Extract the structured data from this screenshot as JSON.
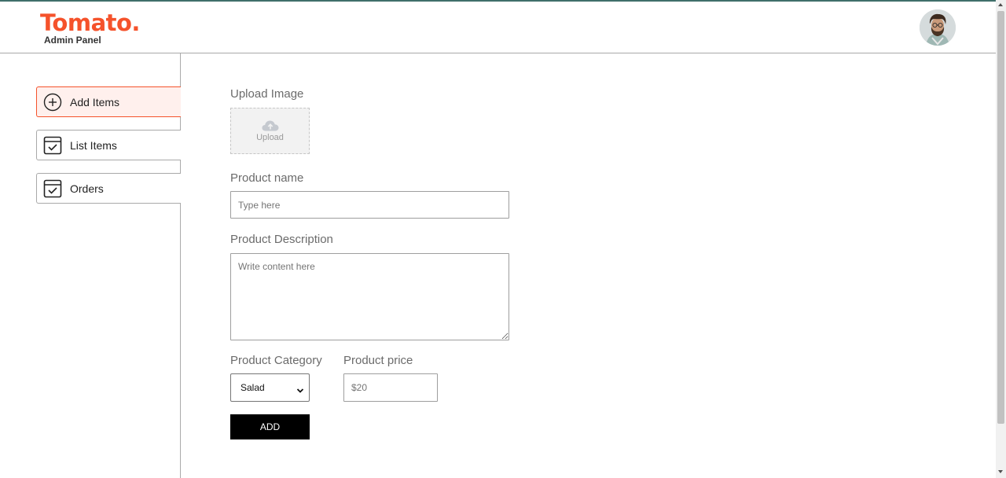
{
  "header": {
    "logo_title": "Tomato.",
    "logo_subtitle": "Admin Panel",
    "avatar_icon": "profile-avatar"
  },
  "sidebar": {
    "items": [
      {
        "label": "Add Items",
        "icon": "add-circle-icon",
        "active": true
      },
      {
        "label": "List Items",
        "icon": "calendar-check-icon",
        "active": false
      },
      {
        "label": "Orders",
        "icon": "calendar-check-icon",
        "active": false
      }
    ]
  },
  "form": {
    "upload_label": "Upload Image",
    "upload_text": "Upload",
    "name_label": "Product name",
    "name_placeholder": "Type here",
    "description_label": "Product Description",
    "description_placeholder": "Write content here",
    "category_label": "Product Category",
    "category_value": "Salad",
    "price_label": "Product price",
    "price_placeholder": "$20",
    "add_button_label": "ADD"
  },
  "colors": {
    "brand": "#f5522b",
    "active_bg": "#fff0ed",
    "top_strip": "#3f6f6a"
  }
}
